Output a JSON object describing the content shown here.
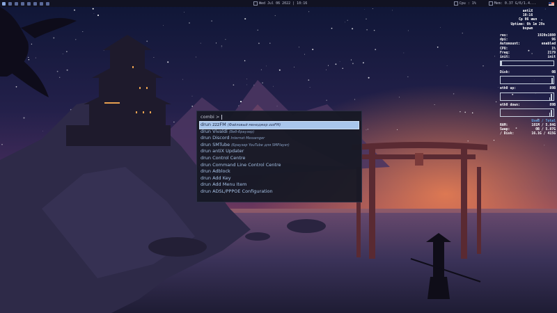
{
  "topbar": {
    "clock": "Wed Jul 06 2022 | 10:16",
    "cpu": "Cpu : 1%",
    "memory": "Mem: 0.37 G/6/1.4..."
  },
  "conky": {
    "hostname": "antiX",
    "time": "10:16",
    "date": "Ср 06 июл",
    "uptime": "Uptime: 0h 1m 29s",
    "wm": "bspwm",
    "rows": [
      {
        "label": "res:",
        "value": "1920x1080"
      },
      {
        "label": "dpi:",
        "value": "96"
      },
      {
        "label": "Automount:",
        "value": "enabled"
      },
      {
        "label": "CPU:",
        "value": "1%"
      },
      {
        "label": "Freq:",
        "value": "2179"
      },
      {
        "label": "init:",
        "value": "init"
      }
    ],
    "disk": {
      "label": "Disk:",
      "value": "0B",
      "level": 0
    },
    "eth_up": {
      "label": "eth0 up:",
      "value": "89B"
    },
    "eth_down": {
      "label": "eth0 down:",
      "value": "89B"
    },
    "mem_header": "Used / Total",
    "mem_rows": [
      {
        "label": "RAM:",
        "value": "181M / 5.84G"
      },
      {
        "label": "Swap:",
        "value": "0B / 5.87G"
      },
      {
        "label": "/ Disk:",
        "value": "16.1G / 415G"
      }
    ]
  },
  "launcher": {
    "prompt": "combi >",
    "input_value": "",
    "results": [
      {
        "label": "drun zzzFM",
        "comment": "(Файловый менеджер zzzFM)",
        "selected": true
      },
      {
        "label": "drun Vivaldi",
        "comment": "(Веб-браузер)"
      },
      {
        "label": "drun Discord",
        "comment": "Internet Messenger"
      },
      {
        "label": "drun SMTube",
        "comment": "(Браузер YouTube для SMPlayer)"
      },
      {
        "label": "drun antiX Updater",
        "comment": ""
      },
      {
        "label": "drun Control Centre",
        "comment": ""
      },
      {
        "label": "drun Command Line Control Centre",
        "comment": ""
      },
      {
        "label": "drun Adblock",
        "comment": ""
      },
      {
        "label": "drun Add Key",
        "comment": ""
      },
      {
        "label": "drun Add Menu Item",
        "comment": ""
      },
      {
        "label": "drun ADSL/PPPOE Configuration",
        "comment": ""
      }
    ]
  },
  "colors": {
    "selection": "#a9c6ec",
    "launcher_bg": "#161824",
    "accent_blue": "#5fa8e8"
  }
}
